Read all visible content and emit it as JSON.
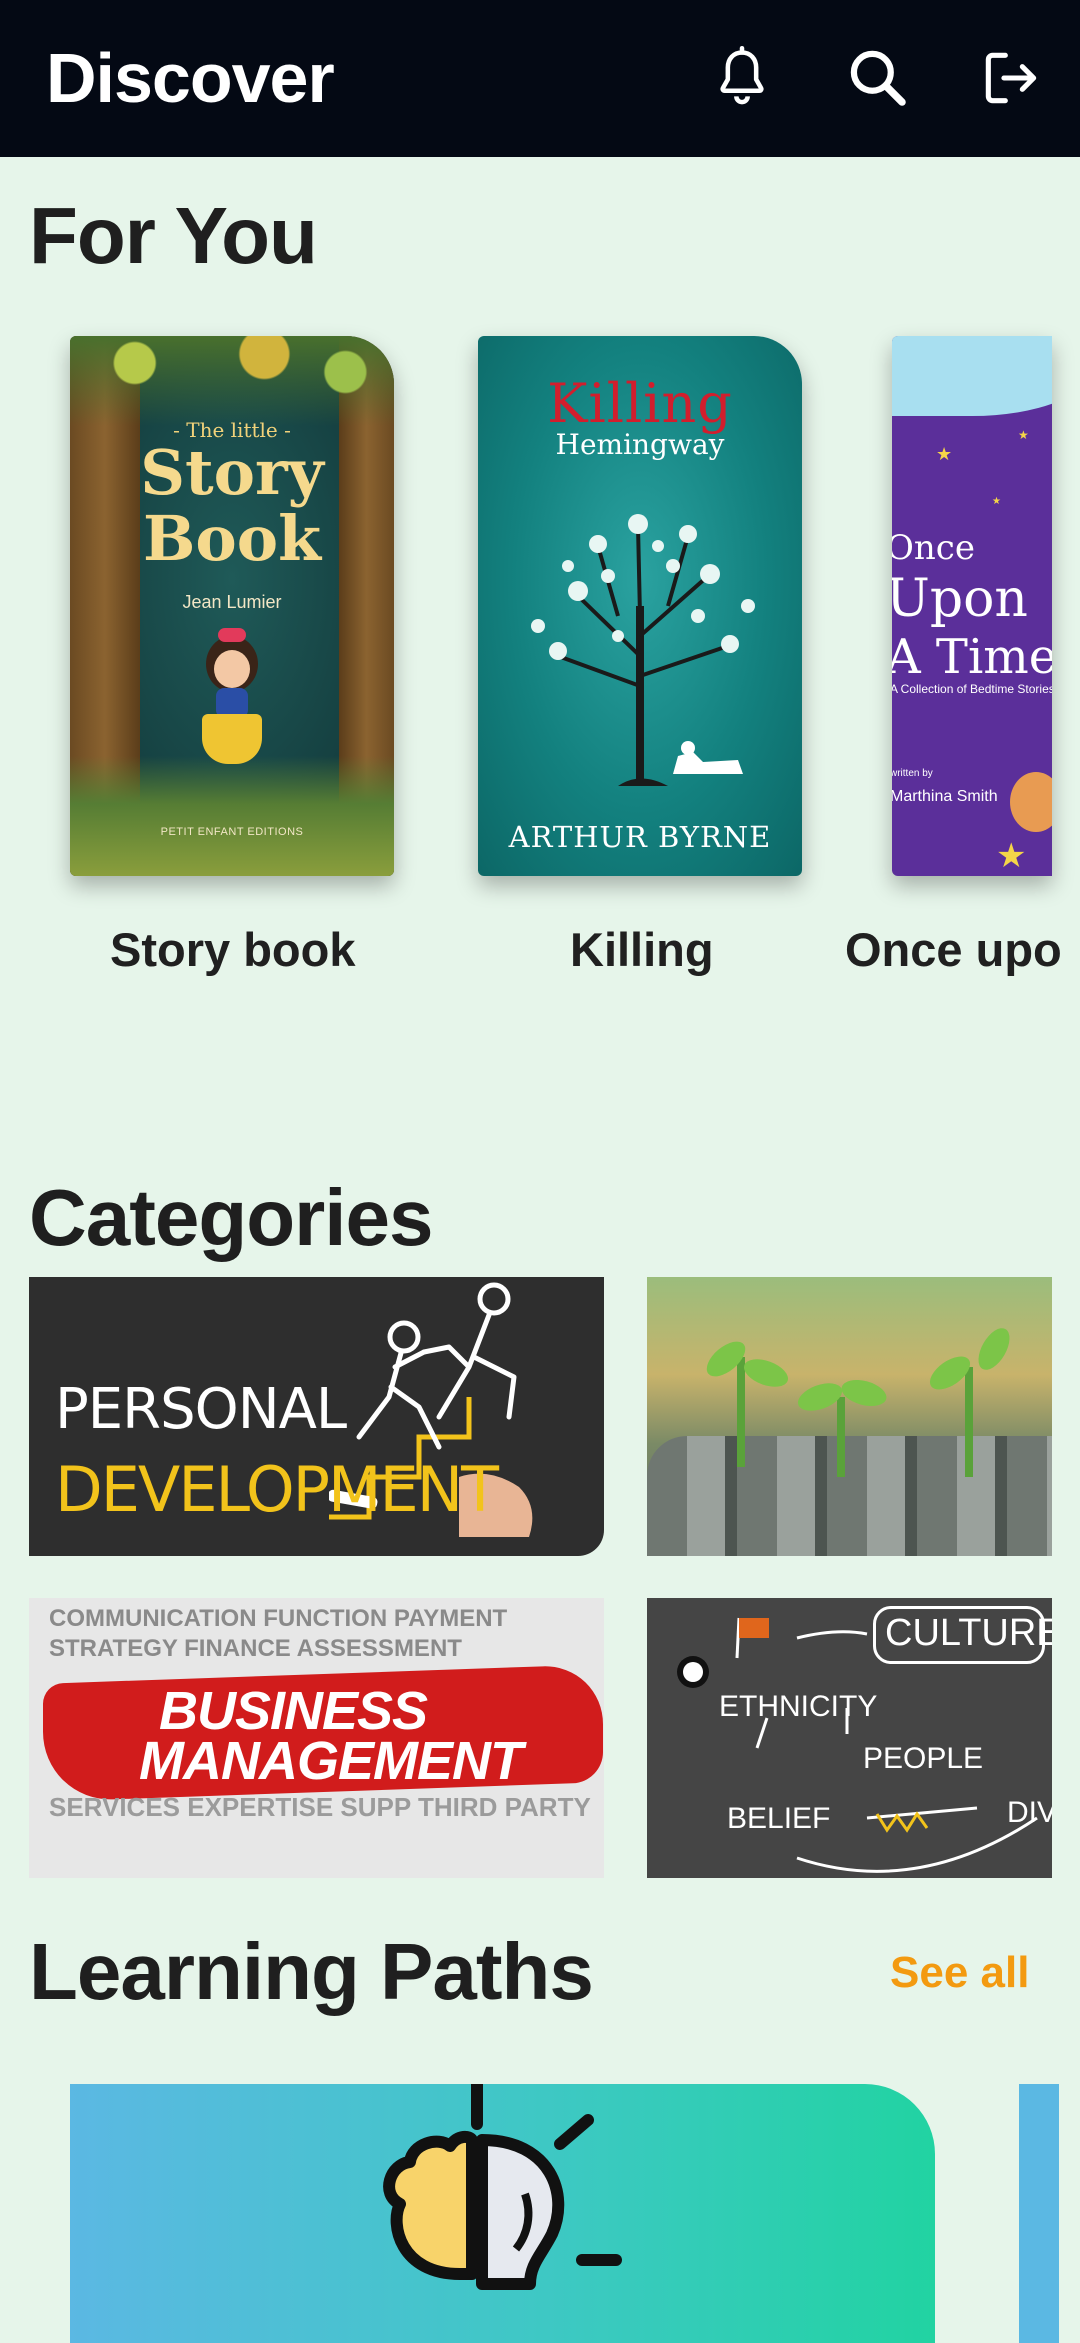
{
  "header": {
    "title": "Discover",
    "icons": [
      "bell-icon",
      "search-icon",
      "logout-icon"
    ]
  },
  "for_you": {
    "title": "For You",
    "books": [
      {
        "label": "Story book",
        "cover": {
          "small_title": "- The little -",
          "title": "Story Book",
          "author": "Jean Lumier",
          "publisher": "PETIT ENFANT EDITIONS"
        }
      },
      {
        "label": "Killing",
        "cover": {
          "title": "Killing",
          "subtitle": "Hemingway",
          "author": "ARTHUR BYRNE"
        }
      },
      {
        "label": "Once upo",
        "cover": {
          "title_line1": "Once",
          "title_line2": "Upon",
          "title_line3": "A Time",
          "subtitle": "A Collection of Bedtime Stories",
          "written_by": "written by",
          "author": "Marthina Smith"
        }
      }
    ]
  },
  "categories": {
    "title": "Categories",
    "personal": {
      "line1": "PERSONAL",
      "line2": "DEVELOPMENT"
    },
    "business": {
      "top_words": "COMMUNICATION  FUNCTION  PAYMENT STRATEGY FINANCE ASSESSMENT",
      "line1": "BUSINESS",
      "line2": "MANAGEMENT",
      "bottom_words": "SERVICES  EXPERTISE  SUPP THIRD PARTY"
    },
    "culture": {
      "box": "CULTURE",
      "w1": "ETHNICITY",
      "w2": "PEOPLE",
      "w3": "BELIEF",
      "w4": "DIV"
    }
  },
  "learning_paths": {
    "title": "Learning Paths",
    "see_all": "See all"
  },
  "colors": {
    "background": "#e6f5ea",
    "header": "#040914",
    "accent": "#f39a10"
  }
}
